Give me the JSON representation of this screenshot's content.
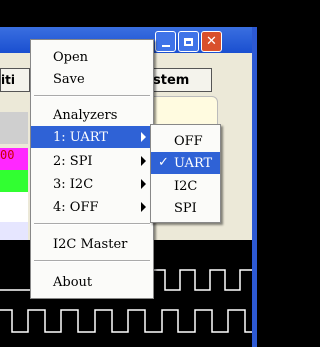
{
  "background": {
    "toolbar_button_label": "stem",
    "left_button_label": "iti",
    "magenta_label": "00"
  },
  "menu": {
    "items": [
      {
        "label": "Open",
        "arrow": false
      },
      {
        "label": "Save",
        "arrow": false
      },
      {
        "label": "Analyzers",
        "arrow": false
      },
      {
        "label": "1: UART",
        "arrow": true,
        "selected": true
      },
      {
        "label": "2: SPI",
        "arrow": true
      },
      {
        "label": "3: I2C",
        "arrow": true
      },
      {
        "label": "4: OFF",
        "arrow": true
      },
      {
        "label": "I2C Master",
        "arrow": false
      },
      {
        "label": "About",
        "arrow": false
      }
    ]
  },
  "submenu": {
    "items": [
      {
        "label": "OFF"
      },
      {
        "label": "UART",
        "checked": true,
        "selected": true
      },
      {
        "label": "I2C"
      },
      {
        "label": "SPI"
      }
    ],
    "check_glyph": "✓"
  },
  "colors": {
    "highlight": "#2f62d6",
    "titlebar": "#1a4fd0",
    "close_button": "#d9502c"
  }
}
